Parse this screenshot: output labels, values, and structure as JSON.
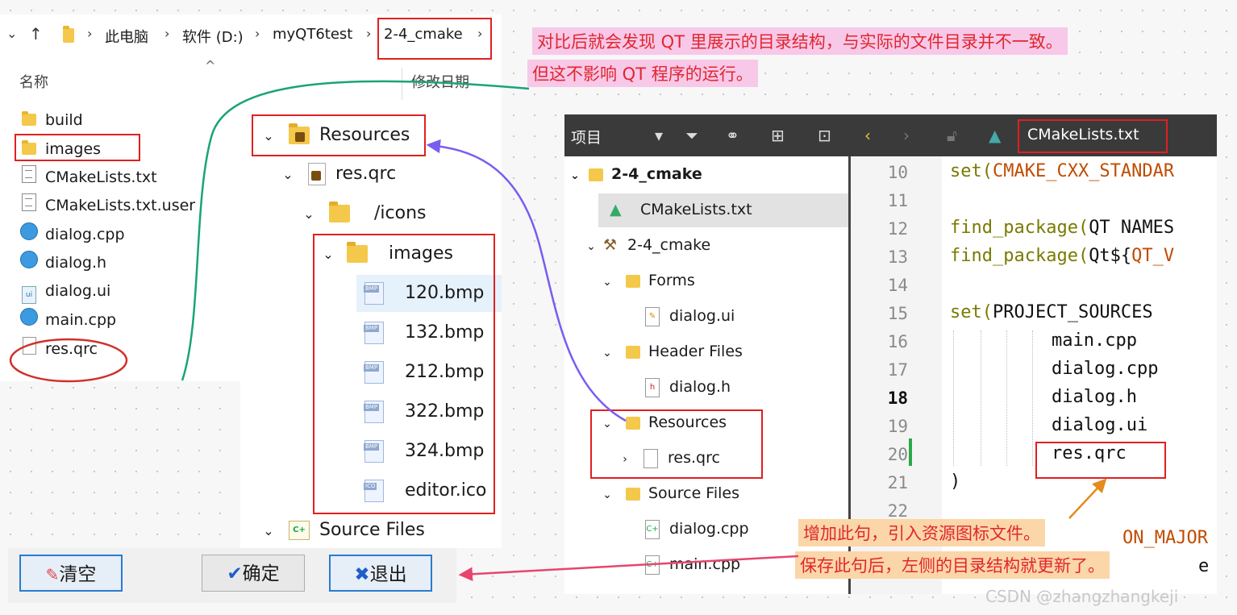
{
  "explorer": {
    "breadcrumb": [
      "此电脑",
      "软件 (D:)",
      "myQT6test",
      "2-4_cmake"
    ],
    "col_name": "名称",
    "col_date": "修改日期",
    "files": [
      "build",
      "images",
      "CMakeLists.txt",
      "CMakeLists.txt.user",
      "dialog.cpp",
      "dialog.h",
      "dialog.ui",
      "main.cpp",
      "res.qrc"
    ]
  },
  "tree": {
    "resources": "Resources",
    "qrc": "res.qrc",
    "icons": "/icons",
    "images": "images",
    "files": [
      "120.bmp",
      "132.bmp",
      "212.bmp",
      "322.bmp",
      "324.bmp",
      "editor.ico"
    ],
    "source_files": "Source Files"
  },
  "buttons": {
    "clear": "清空",
    "ok": "确定",
    "exit": "退出"
  },
  "qt": {
    "project_label": "项目",
    "editor_file": "CMakeLists.txt",
    "project": {
      "root": "2-4_cmake",
      "cmakelists": "CMakeLists.txt",
      "target": "2-4_cmake",
      "forms": "Forms",
      "form_file": "dialog.ui",
      "headers": "Header Files",
      "header_file": "dialog.h",
      "resources": "Resources",
      "res_file": "res.qrc",
      "sources": "Source Files",
      "src_files": [
        "dialog.cpp",
        "main.cpp"
      ]
    },
    "line_numbers": [
      "10",
      "11",
      "12",
      "13",
      "14",
      "15",
      "16",
      "17",
      "18",
      "19",
      "20",
      "21",
      "22"
    ],
    "code": {
      "l10_kw": "set(",
      "l10_arg": "CMAKE_CXX_STANDAR",
      "l12_kw": "find_package(",
      "l12_rest": "QT NAMES",
      "l13_kw": "find_package(",
      "l13_rest": "Qt${",
      "l13_arg": "QT_V",
      "l15_kw": "set(",
      "l15_rest": "PROJECT_SOURCES",
      "l16": "main.cpp",
      "l17": "dialog.cpp",
      "l18": "dialog.h",
      "l19": "dialog.ui",
      "l20": "res.qrc",
      "l21": ")",
      "l23_partial": "ON_MAJOR",
      "l24_partial": "e"
    }
  },
  "annotations": {
    "top_line1": "对比后就会发现 QT 里展示的目录结构，与实际的文件目录并不一致。",
    "top_line2": "但这不影响 QT 程序的运行。",
    "bottom_line1": "增加此句，引入资源图标文件。",
    "bottom_line2": "保存此句后，左侧的目录结构就更新了。"
  },
  "watermark": "CSDN @zhangzhangkeji",
  "colors": {
    "red_box": "#e02020",
    "note_text": "#e0262f",
    "pink_bg": "#f8c8e8",
    "peach_bg": "#fbd6a8",
    "teal_arrow": "#1aa37a",
    "purple_arrow": "#7b5cf0",
    "pink_arrow": "#e8456e",
    "orange_arrow": "#e38b1e"
  }
}
